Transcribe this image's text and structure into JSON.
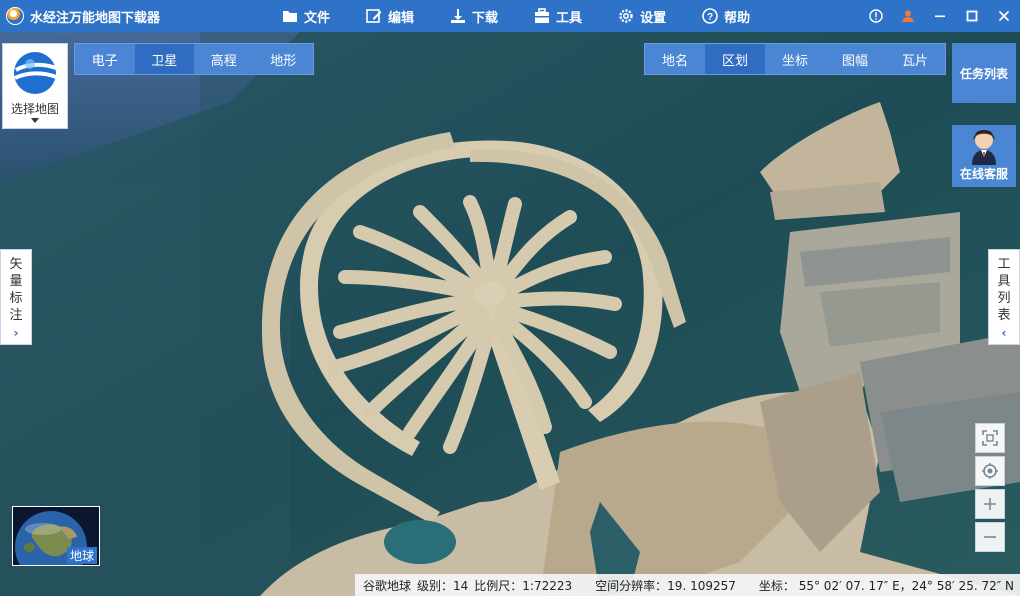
{
  "app": {
    "title": "水经注万能地图下载器"
  },
  "menu": [
    {
      "label": "文件",
      "icon": "folder-icon"
    },
    {
      "label": "编辑",
      "icon": "edit-icon"
    },
    {
      "label": "下载",
      "icon": "download-icon"
    },
    {
      "label": "工具",
      "icon": "toolbox-icon"
    },
    {
      "label": "设置",
      "icon": "gear-icon"
    },
    {
      "label": "帮助",
      "icon": "help-icon"
    }
  ],
  "window_controls": [
    "info-icon",
    "user-icon",
    "minimize-icon",
    "maximize-icon",
    "close-icon"
  ],
  "map_types": {
    "items": [
      "电子",
      "卫星",
      "高程",
      "地形"
    ],
    "active": "卫星"
  },
  "overlays": {
    "items": [
      "地名",
      "区划",
      "坐标",
      "图幅",
      "瓦片"
    ],
    "active": "区划"
  },
  "select_map": {
    "label": "选择地图"
  },
  "task_list": {
    "label": "任务列表"
  },
  "customer_service": {
    "label": "在线客服"
  },
  "vector_tab": {
    "label": "矢量标注",
    "arrow": "›"
  },
  "tools_tab": {
    "label": "工具列表",
    "arrow": "‹"
  },
  "earth": {
    "label": "地球"
  },
  "status": {
    "source": "谷歌地球",
    "level": "级别：14",
    "scale": "比例尺：1:72223",
    "resolution": "空间分辨率：19. 109257",
    "coords": "坐标： 55° 02′ 07. 17″ E，24° 58′ 25. 72″ N"
  },
  "colors": {
    "titlebar": "#2f73c9",
    "panel": "#4a86d3",
    "panel_active": "#2f6cc2",
    "water": "#1f4a52",
    "sand": "#c9bca4"
  }
}
